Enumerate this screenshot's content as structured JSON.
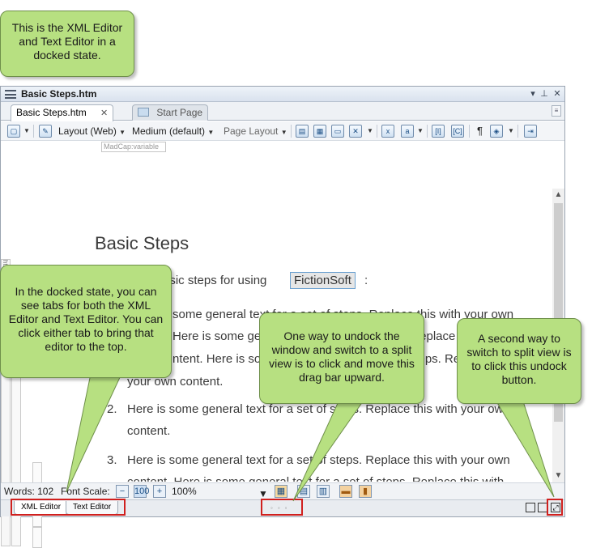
{
  "callouts": {
    "top_left": "This is the XML Editor and Text Editor in a docked state.",
    "docked_tabs": "In the docked state, you can see tabs for both the XML Editor and Text Editor. You can click either tab to bring that editor to the top.",
    "drag_bar": "One way to undock the window and switch to a split view is to click and move this drag bar upward.",
    "undock_button": "A second way to switch to split view is to click this undock button."
  },
  "window": {
    "title": "Basic Steps.htm",
    "tabs": [
      {
        "label": "Basic Steps.htm",
        "close": "✕"
      },
      {
        "label": "Start Page"
      }
    ]
  },
  "toolbar": {
    "layout_label": "Layout (Web)",
    "medium_label": "Medium (default)",
    "page_layout_label": "Page Layout",
    "variable_label": "MadCap:variable"
  },
  "structure": {
    "html": "html",
    "body": "body",
    "h1": "h1"
  },
  "document": {
    "heading": "Basic Steps",
    "intro_prefix": "asic steps for using",
    "variable": "FictionSoft",
    "intro_suffix": ":",
    "list": [
      {
        "num": "",
        "line1": "some general text for a set of steps. Replace this with your own",
        "line2": "Here is some general text for a set of steps. Replace this with your own",
        "line3": "ntent. Here is some general text for a set of steps. Replace this with",
        "line4": "your own content."
      },
      {
        "num": "2.",
        "line1": "Here is some general text for a set of steps. Replace this with your own",
        "line2": "content."
      },
      {
        "num": "3.",
        "line1": "Here is some general text for a set of steps. Replace this with your own",
        "line2": "content. Here is some general text for a set of steps. Replace this with"
      }
    ]
  },
  "statusbar": {
    "words": "Words: 102",
    "font_scale": "Font Scale:",
    "zoom": "100%"
  },
  "bottom_tabs": [
    "XML Editor",
    "Text Editor"
  ],
  "colors": {
    "callout": "#b7e081",
    "highlight": "#d0201e"
  }
}
